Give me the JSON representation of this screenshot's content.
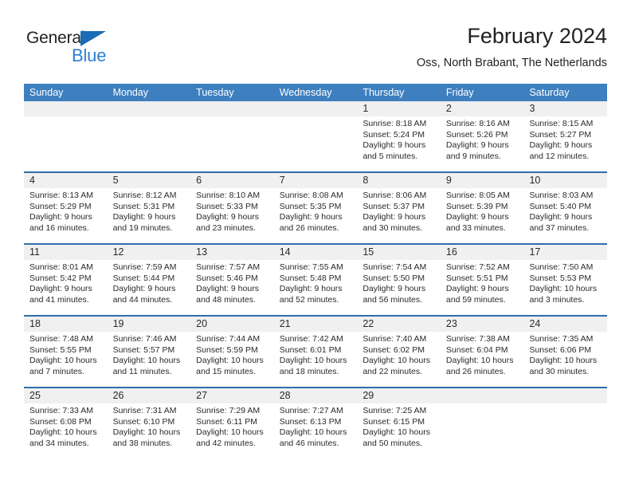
{
  "brand": {
    "name_dark": "General",
    "name_blue": "Blue",
    "accent_color": "#2a7fd4",
    "triangle_color": "#1b6cb5"
  },
  "header": {
    "title": "February 2024",
    "location": "Oss, North Brabant, The Netherlands"
  },
  "calendar": {
    "header_bg": "#3d7fbf",
    "row_divider_color": "#2f6fae",
    "daynum_bg": "#f0f0f0",
    "weekdays": [
      "Sunday",
      "Monday",
      "Tuesday",
      "Wednesday",
      "Thursday",
      "Friday",
      "Saturday"
    ],
    "weeks": [
      {
        "days": [
          {
            "num": "",
            "empty": true,
            "sunrise": "",
            "sunset": "",
            "daylight1": "",
            "daylight2": ""
          },
          {
            "num": "",
            "empty": true,
            "sunrise": "",
            "sunset": "",
            "daylight1": "",
            "daylight2": ""
          },
          {
            "num": "",
            "empty": true,
            "sunrise": "",
            "sunset": "",
            "daylight1": "",
            "daylight2": ""
          },
          {
            "num": "",
            "empty": true,
            "sunrise": "",
            "sunset": "",
            "daylight1": "",
            "daylight2": ""
          },
          {
            "num": "1",
            "empty": false,
            "sunrise": "Sunrise: 8:18 AM",
            "sunset": "Sunset: 5:24 PM",
            "daylight1": "Daylight: 9 hours",
            "daylight2": "and 5 minutes."
          },
          {
            "num": "2",
            "empty": false,
            "sunrise": "Sunrise: 8:16 AM",
            "sunset": "Sunset: 5:26 PM",
            "daylight1": "Daylight: 9 hours",
            "daylight2": "and 9 minutes."
          },
          {
            "num": "3",
            "empty": false,
            "sunrise": "Sunrise: 8:15 AM",
            "sunset": "Sunset: 5:27 PM",
            "daylight1": "Daylight: 9 hours",
            "daylight2": "and 12 minutes."
          }
        ]
      },
      {
        "days": [
          {
            "num": "4",
            "empty": false,
            "sunrise": "Sunrise: 8:13 AM",
            "sunset": "Sunset: 5:29 PM",
            "daylight1": "Daylight: 9 hours",
            "daylight2": "and 16 minutes."
          },
          {
            "num": "5",
            "empty": false,
            "sunrise": "Sunrise: 8:12 AM",
            "sunset": "Sunset: 5:31 PM",
            "daylight1": "Daylight: 9 hours",
            "daylight2": "and 19 minutes."
          },
          {
            "num": "6",
            "empty": false,
            "sunrise": "Sunrise: 8:10 AM",
            "sunset": "Sunset: 5:33 PM",
            "daylight1": "Daylight: 9 hours",
            "daylight2": "and 23 minutes."
          },
          {
            "num": "7",
            "empty": false,
            "sunrise": "Sunrise: 8:08 AM",
            "sunset": "Sunset: 5:35 PM",
            "daylight1": "Daylight: 9 hours",
            "daylight2": "and 26 minutes."
          },
          {
            "num": "8",
            "empty": false,
            "sunrise": "Sunrise: 8:06 AM",
            "sunset": "Sunset: 5:37 PM",
            "daylight1": "Daylight: 9 hours",
            "daylight2": "and 30 minutes."
          },
          {
            "num": "9",
            "empty": false,
            "sunrise": "Sunrise: 8:05 AM",
            "sunset": "Sunset: 5:39 PM",
            "daylight1": "Daylight: 9 hours",
            "daylight2": "and 33 minutes."
          },
          {
            "num": "10",
            "empty": false,
            "sunrise": "Sunrise: 8:03 AM",
            "sunset": "Sunset: 5:40 PM",
            "daylight1": "Daylight: 9 hours",
            "daylight2": "and 37 minutes."
          }
        ]
      },
      {
        "days": [
          {
            "num": "11",
            "empty": false,
            "sunrise": "Sunrise: 8:01 AM",
            "sunset": "Sunset: 5:42 PM",
            "daylight1": "Daylight: 9 hours",
            "daylight2": "and 41 minutes."
          },
          {
            "num": "12",
            "empty": false,
            "sunrise": "Sunrise: 7:59 AM",
            "sunset": "Sunset: 5:44 PM",
            "daylight1": "Daylight: 9 hours",
            "daylight2": "and 44 minutes."
          },
          {
            "num": "13",
            "empty": false,
            "sunrise": "Sunrise: 7:57 AM",
            "sunset": "Sunset: 5:46 PM",
            "daylight1": "Daylight: 9 hours",
            "daylight2": "and 48 minutes."
          },
          {
            "num": "14",
            "empty": false,
            "sunrise": "Sunrise: 7:55 AM",
            "sunset": "Sunset: 5:48 PM",
            "daylight1": "Daylight: 9 hours",
            "daylight2": "and 52 minutes."
          },
          {
            "num": "15",
            "empty": false,
            "sunrise": "Sunrise: 7:54 AM",
            "sunset": "Sunset: 5:50 PM",
            "daylight1": "Daylight: 9 hours",
            "daylight2": "and 56 minutes."
          },
          {
            "num": "16",
            "empty": false,
            "sunrise": "Sunrise: 7:52 AM",
            "sunset": "Sunset: 5:51 PM",
            "daylight1": "Daylight: 9 hours",
            "daylight2": "and 59 minutes."
          },
          {
            "num": "17",
            "empty": false,
            "sunrise": "Sunrise: 7:50 AM",
            "sunset": "Sunset: 5:53 PM",
            "daylight1": "Daylight: 10 hours",
            "daylight2": "and 3 minutes."
          }
        ]
      },
      {
        "days": [
          {
            "num": "18",
            "empty": false,
            "sunrise": "Sunrise: 7:48 AM",
            "sunset": "Sunset: 5:55 PM",
            "daylight1": "Daylight: 10 hours",
            "daylight2": "and 7 minutes."
          },
          {
            "num": "19",
            "empty": false,
            "sunrise": "Sunrise: 7:46 AM",
            "sunset": "Sunset: 5:57 PM",
            "daylight1": "Daylight: 10 hours",
            "daylight2": "and 11 minutes."
          },
          {
            "num": "20",
            "empty": false,
            "sunrise": "Sunrise: 7:44 AM",
            "sunset": "Sunset: 5:59 PM",
            "daylight1": "Daylight: 10 hours",
            "daylight2": "and 15 minutes."
          },
          {
            "num": "21",
            "empty": false,
            "sunrise": "Sunrise: 7:42 AM",
            "sunset": "Sunset: 6:01 PM",
            "daylight1": "Daylight: 10 hours",
            "daylight2": "and 18 minutes."
          },
          {
            "num": "22",
            "empty": false,
            "sunrise": "Sunrise: 7:40 AM",
            "sunset": "Sunset: 6:02 PM",
            "daylight1": "Daylight: 10 hours",
            "daylight2": "and 22 minutes."
          },
          {
            "num": "23",
            "empty": false,
            "sunrise": "Sunrise: 7:38 AM",
            "sunset": "Sunset: 6:04 PM",
            "daylight1": "Daylight: 10 hours",
            "daylight2": "and 26 minutes."
          },
          {
            "num": "24",
            "empty": false,
            "sunrise": "Sunrise: 7:35 AM",
            "sunset": "Sunset: 6:06 PM",
            "daylight1": "Daylight: 10 hours",
            "daylight2": "and 30 minutes."
          }
        ]
      },
      {
        "days": [
          {
            "num": "25",
            "empty": false,
            "sunrise": "Sunrise: 7:33 AM",
            "sunset": "Sunset: 6:08 PM",
            "daylight1": "Daylight: 10 hours",
            "daylight2": "and 34 minutes."
          },
          {
            "num": "26",
            "empty": false,
            "sunrise": "Sunrise: 7:31 AM",
            "sunset": "Sunset: 6:10 PM",
            "daylight1": "Daylight: 10 hours",
            "daylight2": "and 38 minutes."
          },
          {
            "num": "27",
            "empty": false,
            "sunrise": "Sunrise: 7:29 AM",
            "sunset": "Sunset: 6:11 PM",
            "daylight1": "Daylight: 10 hours",
            "daylight2": "and 42 minutes."
          },
          {
            "num": "28",
            "empty": false,
            "sunrise": "Sunrise: 7:27 AM",
            "sunset": "Sunset: 6:13 PM",
            "daylight1": "Daylight: 10 hours",
            "daylight2": "and 46 minutes."
          },
          {
            "num": "29",
            "empty": false,
            "sunrise": "Sunrise: 7:25 AM",
            "sunset": "Sunset: 6:15 PM",
            "daylight1": "Daylight: 10 hours",
            "daylight2": "and 50 minutes."
          },
          {
            "num": "",
            "empty": true,
            "sunrise": "",
            "sunset": "",
            "daylight1": "",
            "daylight2": ""
          },
          {
            "num": "",
            "empty": true,
            "sunrise": "",
            "sunset": "",
            "daylight1": "",
            "daylight2": ""
          }
        ]
      }
    ]
  }
}
